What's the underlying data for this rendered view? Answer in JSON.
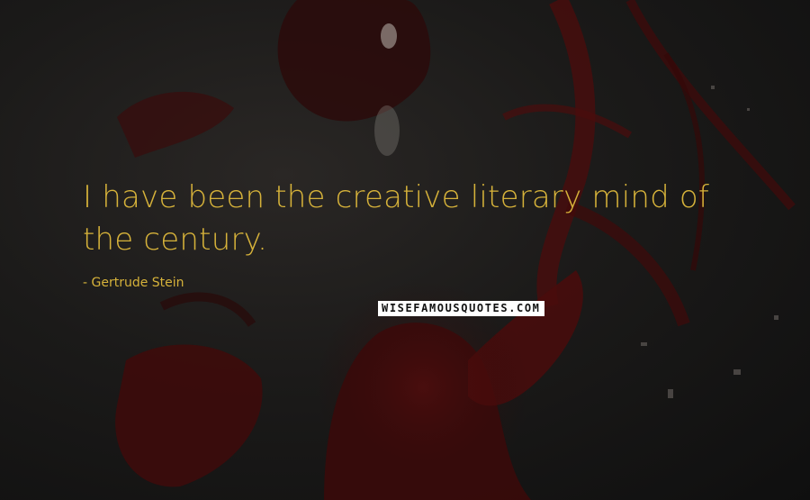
{
  "quote": {
    "text": "I have been the creative literary mind of the century.",
    "author": "- Gertrude Stein"
  },
  "watermark": {
    "text": "WISEFAMOUSQUOTES.COM"
  },
  "colors": {
    "quote_text": "#d6b23a",
    "background": "#1b1a19",
    "accent_red": "#6e1414"
  }
}
